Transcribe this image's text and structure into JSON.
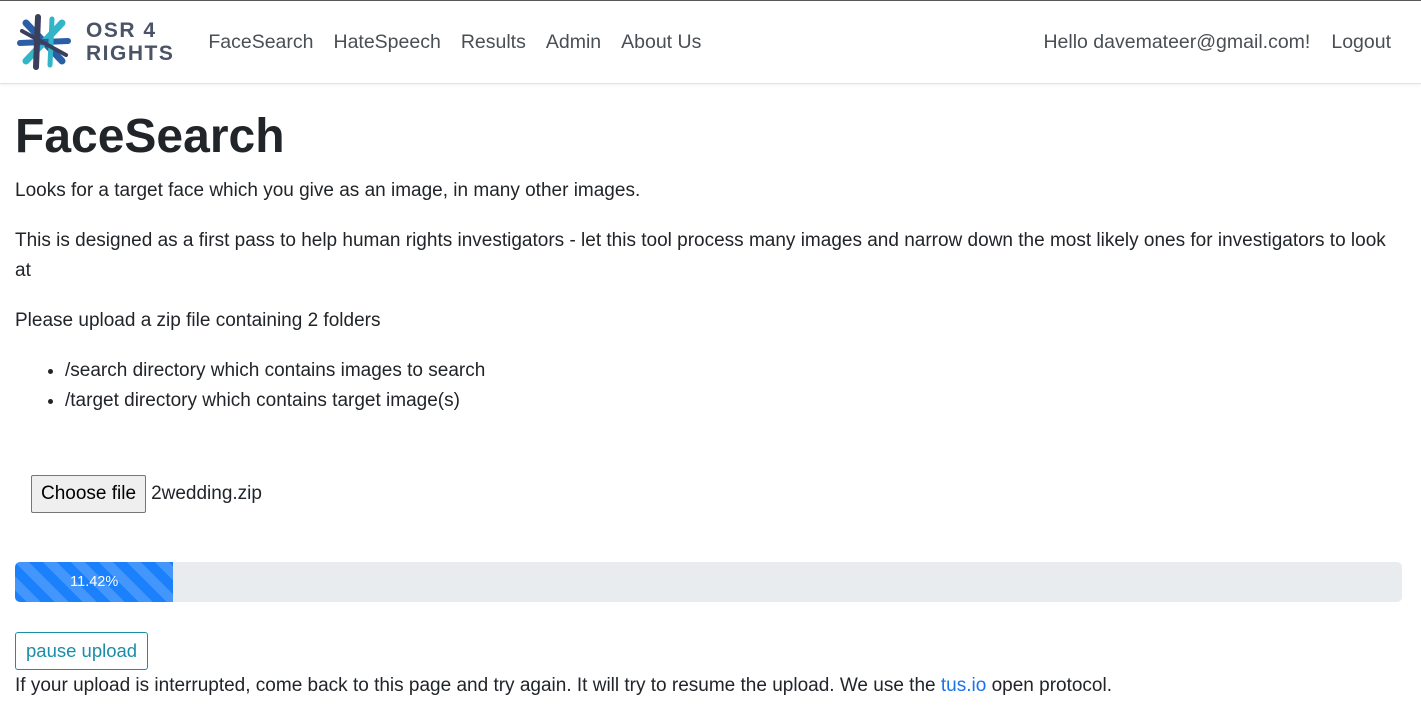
{
  "brand": {
    "line1": "OSR 4",
    "line2": "RIGHTS",
    "logo_icon": "osr4rights-logo-icon",
    "colors": [
      "#2a5fa8",
      "#33b5c8",
      "#3a3f5c"
    ]
  },
  "nav": {
    "items": [
      {
        "label": "FaceSearch"
      },
      {
        "label": "HateSpeech"
      },
      {
        "label": "Results"
      },
      {
        "label": "Admin"
      },
      {
        "label": "About Us"
      }
    ],
    "hello": "Hello davemateer@gmail.com!",
    "logout": "Logout"
  },
  "main": {
    "title": "FaceSearch",
    "intro": "Looks for a target face which you give as an image, in many other images.",
    "description": "This is designed as a first pass to help human rights investigators - let this tool process many images and narrow down the most likely ones for investigators to look at",
    "upload_instruction": "Please upload a zip file containing 2 folders",
    "folders": [
      "/search directory which contains images to search",
      "/target directory which contains target image(s)"
    ],
    "file_input": {
      "button_label": "Choose file",
      "file_name": "2wedding.zip"
    },
    "progress": {
      "percent": 11.42,
      "label": "11.42%",
      "color": "#1a80fb"
    },
    "pause_label": "pause upload",
    "note_before": "If your upload is interrupted, come back to this page and try again. It will try to resume the upload. We use the ",
    "note_link": "tus.io",
    "note_after": " open protocol."
  }
}
